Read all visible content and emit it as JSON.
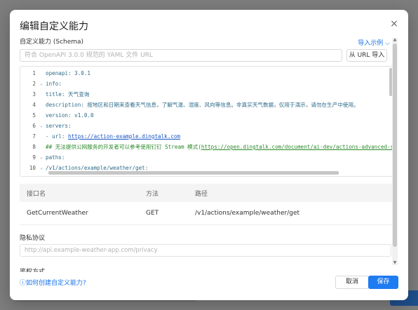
{
  "modal": {
    "title": "编辑自定义能力",
    "close_icon": "×"
  },
  "schema": {
    "label": "自定义能力 (Schema)",
    "import_example": "导入示例",
    "url_placeholder": "符合 OpenAPI 3.0.0 规范的 YAML 文件 URL",
    "url_import_button": "从 URL 导入"
  },
  "editor": {
    "lines": [
      {
        "n": "1",
        "fold": "",
        "text": "openapi: 3.0.1"
      },
      {
        "n": "2",
        "fold": "⌄",
        "text": "info:"
      },
      {
        "n": "3",
        "fold": "",
        "text": "  title: 天气查询"
      },
      {
        "n": "4",
        "fold": "",
        "text": "  description: 按地区和日期来查看天气信息，了解气温、湿度、风向等信息。非真实天气数据，仅用于演示，请勿在生产中使用。"
      },
      {
        "n": "5",
        "fold": "",
        "text": "  version: v1.0.0"
      },
      {
        "n": "6",
        "fold": "⌄",
        "text": "servers:"
      },
      {
        "n": "7",
        "fold": "",
        "text": "  - url: https://action-example.dingtalk.com"
      },
      {
        "n": "8",
        "fold": "",
        "text": "## 无法提供公网服务的开发者可以参考使用钉钉 Stream 模式(https://open.dingtalk.com/document/ai-dev/actions-advanced-sett"
      },
      {
        "n": "9",
        "fold": "⌄",
        "text": "paths:"
      },
      {
        "n": "10",
        "fold": "⌄",
        "text": "  /v1/actions/example/weather/get:"
      }
    ]
  },
  "table": {
    "headers": [
      "接口名",
      "方法",
      "路径"
    ],
    "rows": [
      {
        "name": "GetCurrentWeather",
        "method": "GET",
        "path": "/v1/actions/example/weather/get"
      }
    ]
  },
  "privacy": {
    "label": "隐私协议",
    "placeholder": "http://api.example-weather-app.com/privacy"
  },
  "auth": {
    "label": "鉴权方式"
  },
  "footer": {
    "help_link": "如何创建自定义能力?",
    "cancel": "取消",
    "save": "保存"
  }
}
